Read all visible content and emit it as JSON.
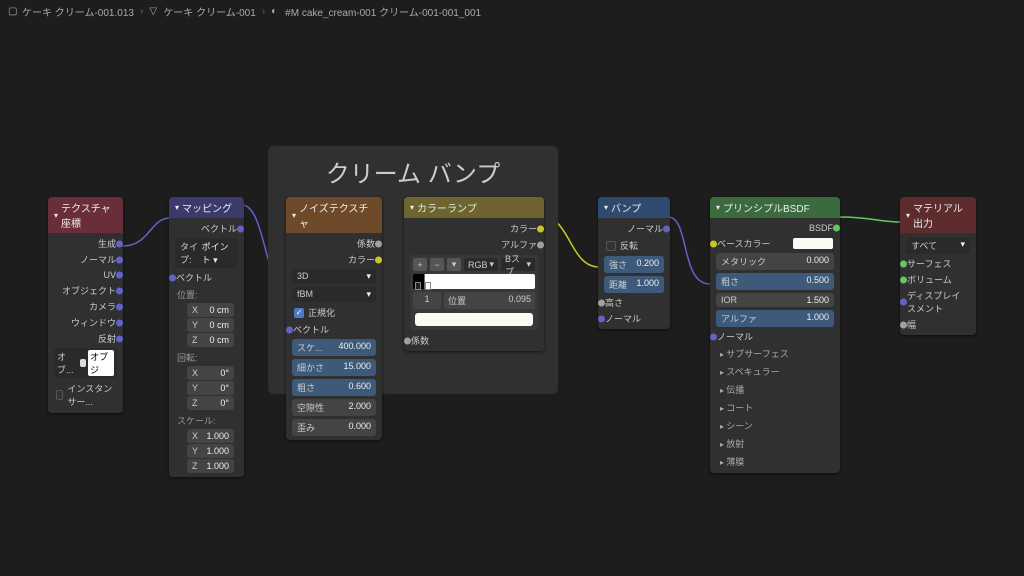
{
  "breadcrumb": {
    "item1": "ケーキ クリーム-001.013",
    "item2": "ケーキ クリーム-001",
    "item3": "#M cake_cream-001 クリーム-001-001_001"
  },
  "frame": {
    "title": "クリーム バンプ"
  },
  "texcoord": {
    "title": "テクスチャ座標",
    "outs": [
      "生成",
      "ノーマル",
      "UV",
      "オブジェクト",
      "カメラ",
      "ウィンドウ",
      "反射"
    ],
    "obj_label": "オブ...",
    "obj_value": "オブジ",
    "instancer": "インスタンサー..."
  },
  "mapping": {
    "title": "マッピング",
    "out": "ベクトル",
    "type_label": "タイプ:",
    "type_value": "ポイント",
    "vector_in": "ベクトル",
    "location": {
      "label": "位置:",
      "x": "X",
      "xv": "0 cm",
      "y": "Y",
      "yv": "0 cm",
      "z": "Z",
      "zv": "0 cm"
    },
    "rotation": {
      "label": "回転:",
      "x": "X",
      "xv": "0°",
      "y": "Y",
      "yv": "0°",
      "z": "Z",
      "zv": "0°"
    },
    "scale": {
      "label": "スケール:",
      "x": "X",
      "xv": "1.000",
      "y": "Y",
      "yv": "1.000",
      "z": "Z",
      "zv": "1.000"
    }
  },
  "noise": {
    "title": "ノイズテクスチャ",
    "out_fac": "係数",
    "out_color": "カラー",
    "dim": "3D",
    "type": "fBM",
    "normalize": "正規化",
    "vector_in": "ベクトル",
    "scale": {
      "lab": "スケ...",
      "val": "400.000"
    },
    "detail": {
      "lab": "細かさ",
      "val": "15.000"
    },
    "rough": {
      "lab": "粗さ",
      "val": "0.600"
    },
    "lacun": {
      "lab": "空隙性",
      "val": "2.000"
    },
    "distort": {
      "lab": "歪み",
      "val": "0.000"
    }
  },
  "ramp": {
    "title": "カラーランプ",
    "out_color": "カラー",
    "out_alpha": "アルファ",
    "interp1": "RGB",
    "interp2": "Bスプ...",
    "index": "1",
    "pos_label": "位置",
    "pos_value": "0.095",
    "in_fac": "係数"
  },
  "bump": {
    "title": "バンプ",
    "out": "ノーマル",
    "invert": "反転",
    "strength": {
      "lab": "強さ",
      "val": "0.200"
    },
    "distance": {
      "lab": "距離",
      "val": "1.000"
    },
    "height": "高さ",
    "normal": "ノーマル"
  },
  "bsdf": {
    "title": "プリンシプルBSDF",
    "out": "BSDF",
    "base": "ベースカラー",
    "metallic": {
      "lab": "メタリック",
      "val": "0.000"
    },
    "rough": {
      "lab": "粗さ",
      "val": "0.500"
    },
    "ior": {
      "lab": "IOR",
      "val": "1.500"
    },
    "alpha": {
      "lab": "アルファ",
      "val": "1.000"
    },
    "normal": "ノーマル",
    "panels": [
      "サブサーフェス",
      "スペキュラー",
      "伝播",
      "コート",
      "シーン",
      "放射",
      "薄膜"
    ]
  },
  "output": {
    "title": "マテリアル出力",
    "target": "すべて",
    "surface": "サーフェス",
    "volume": "ボリューム",
    "displace": "ディスプレイスメント",
    "thick": "幅"
  }
}
